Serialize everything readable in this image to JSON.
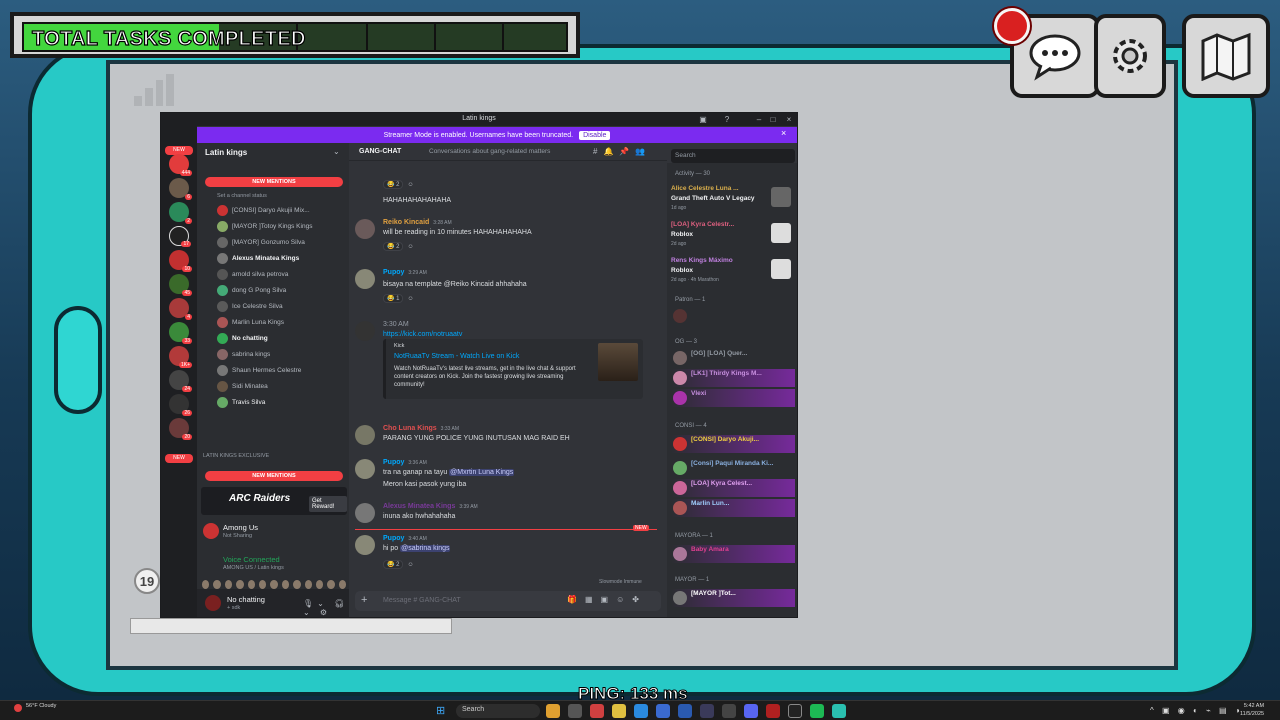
{
  "game": {
    "task_label": "TOTAL TASKS COMPLETED",
    "task_progress": 0.36,
    "ping_text": "PING: 133 ms",
    "room_number": "19"
  },
  "discord": {
    "window_title": "Latin kings",
    "streamer_banner": "Streamer Mode is enabled. Usernames have been truncated.",
    "disable_label": "Disable",
    "server_name": "Latin kings",
    "new_mentions": "NEW MENTIONS",
    "set_status": "Set a channel status",
    "voice_users": [
      "[CONSI] Daryo Akujii Mix...",
      "[MAYOR ]Totoy Kings Kings",
      "[MAYOR] Gonzumo Silva",
      "Alexus Minatea Kings",
      "arnold silva petrova",
      "dong G Pong Silva",
      "Ice Celestre Silva",
      "Marlin Luna Kings",
      "No chatting",
      "sabrina kings",
      "Shaun Hermes Celestre",
      "Sidi Minatea",
      "Travis Silva"
    ],
    "category_label": "LATIN KINGS EXCLUSIVE",
    "promo_label": "ARC Raiders",
    "promo_button": "Get Reward!",
    "activity_name": "Among Us",
    "activity_sub": "Not Sharing",
    "voice_connected": "Voice Connected",
    "voice_path": "AMONG US / Latin kings",
    "user_name": "No chatting",
    "user_sub": "+ sdk",
    "channel_name": "GANG-CHAT",
    "channel_topic": "Conversations about gang-related matters",
    "search_placeholder": "Search",
    "input_placeholder": "Message # GANG-CHAT",
    "slowmode": "Slowmode Immune",
    "messages": [
      {
        "name": "",
        "time": "",
        "text": "HAHAHAHAHAHAHA",
        "react": "2"
      },
      {
        "name": "Reiko Kincaid",
        "time": "3:28 AM",
        "text": "will be reading in 10 minutes HAHAHAHAHAHA",
        "react": "2"
      },
      {
        "name": "Pupoy",
        "time": "3:29 AM",
        "text": "bisaya na template @Reiko Kincaid ahhahaha",
        "react": "1"
      },
      {
        "name": "",
        "time": "3:30 AM",
        "text": "https://kick.com/notruaatv",
        "react": ""
      },
      {
        "name": "Cho Luna Kings",
        "time": "3:33 AM",
        "text": "PARANG YUNG POLICE YUNG INUTUSAN MAG RAID EH",
        "react": ""
      },
      {
        "name": "Pupoy",
        "time": "3:36 AM",
        "text": "tra na ganap na tayu @Mxrtin Luna Kings",
        "react": ""
      },
      {
        "name": "",
        "time": "",
        "text": "Meron kasi pasok yung iba",
        "react": ""
      },
      {
        "name": "Alexus Minatea Kings",
        "time": "3:39 AM",
        "text": "inuna ako hwhahahaha",
        "react": ""
      },
      {
        "name": "Pupoy",
        "time": "3:40 AM",
        "text": "hi po @sabrina kings",
        "react": "2"
      }
    ],
    "embed": {
      "source": "Kick",
      "title": "NotRuaaTv Stream - Watch Live on Kick",
      "desc": "Watch NotRuaaTv's latest live streams, get in the live chat & support content creators on Kick. Join the fastest growing live streaming community!"
    },
    "new_tag": "NEW",
    "members": {
      "activity_header": "Activity — 30",
      "activities": [
        {
          "name": "Alice Celestre Luna ...",
          "game": "Grand Theft Auto V Legacy",
          "time": "1d ago"
        },
        {
          "name": "[LOA] Kyra Celestr...",
          "game": "Roblox",
          "time": "2d ago"
        },
        {
          "name": "Rens Kings Máximo",
          "game": "Roblox",
          "time": "2d ago · 4h Marathon"
        }
      ],
      "patron_header": "Patron — 1",
      "og_header": "OG — 3",
      "og": [
        "[OG] [LOA] Quer...",
        "[LK1] Thirdy Kings M...",
        "Vlexi"
      ],
      "consi_header": "CONSI — 4",
      "consi": [
        "[CONSI] Daryo Akuji...",
        "[Consi] Paqui Miranda Ki...",
        "[LOA] Kyra Celest...",
        "Marlin Lun..."
      ],
      "mayora_header": "MAYORA — 1",
      "mayora": [
        "Baby Amara"
      ],
      "mayor_header": "MAYOR — 1",
      "mayor": [
        "[MAYOR ]Tot..."
      ]
    }
  },
  "taskbar": {
    "weather": "56°F Cloudy",
    "search": "Search",
    "time": "5:42 AM",
    "date": "11/5/2025"
  },
  "colors": {
    "accent": "#7b2bf0",
    "tablet": "#27c9c6",
    "task_fill": "#43d63e"
  }
}
